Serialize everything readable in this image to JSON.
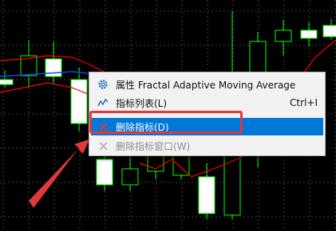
{
  "context_menu": {
    "items": [
      {
        "label": "属性 Fractal Adaptive Moving Average",
        "shortcut": "",
        "icon": "gear-icon",
        "state": "normal"
      },
      {
        "label": "指标列表(L)",
        "shortcut": "Ctrl+I",
        "icon": "indicator-list-icon",
        "state": "normal"
      },
      {
        "label": "删除指标(D)",
        "shortcut": "",
        "icon": "delete-x-icon",
        "state": "selected"
      },
      {
        "label": "删除指标窗口(W)",
        "shortcut": "",
        "icon": "delete-x-icon",
        "state": "disabled"
      }
    ]
  },
  "colors": {
    "background": "#000000",
    "bull_candle": "#00ff00",
    "bear_candle_fill": "#ffffff",
    "indicator_line": "#ff0000",
    "moving_average_line": "#1e3cff",
    "selection": "#0078d7",
    "annotation": "#e0393c"
  }
}
